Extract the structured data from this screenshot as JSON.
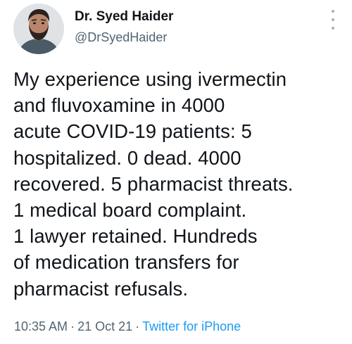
{
  "author": {
    "display_name": "Dr. Syed Haider",
    "handle": "@DrSyedHaider",
    "avatar_icon": "profile-photo"
  },
  "tweet": {
    "lines": [
      "My experience using ivermectin",
      "and fluvoxamine in 4000",
      "acute COVID-19 patients: 5",
      "hospitalized. 0 dead. 4000",
      "recovered. 5 pharmacist threats.",
      "1 medical board complaint.",
      "1 lawyer retained. Hundreds",
      "of medication transfers for",
      "pharmacist refusals."
    ]
  },
  "meta": {
    "time": "10:35 AM",
    "separator": "·",
    "date": "21 Oct 21",
    "source": "Twitter for iPhone"
  },
  "colors": {
    "text": "#0f1419",
    "secondary": "#536471",
    "link": "#1d9bf0"
  },
  "icons": {
    "more": "more-options-icon"
  }
}
